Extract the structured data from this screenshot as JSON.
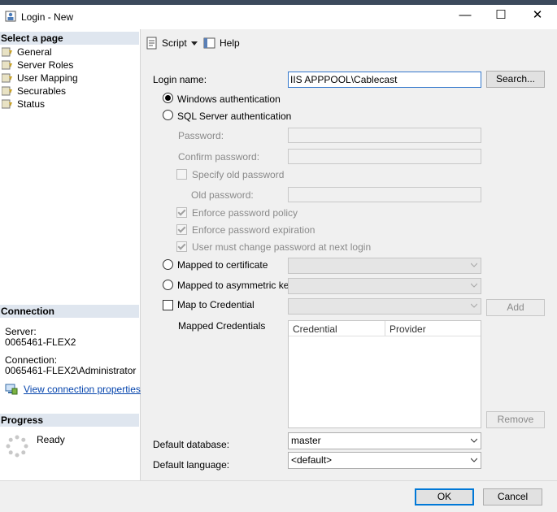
{
  "window": {
    "title": "Login - New",
    "minimize": "—",
    "maximize": "☐",
    "close": "✕"
  },
  "sidebar": {
    "select_page_header": "Select a page",
    "items": [
      {
        "label": "General",
        "icon": "page-icon"
      },
      {
        "label": "Server Roles",
        "icon": "page-icon"
      },
      {
        "label": "User Mapping",
        "icon": "page-icon"
      },
      {
        "label": "Securables",
        "icon": "page-icon"
      },
      {
        "label": "Status",
        "icon": "page-icon"
      }
    ],
    "connection_header": "Connection",
    "server_label": "Server:",
    "server_value": "0065461-FLEX2",
    "connection_label": "Connection:",
    "connection_value": "0065461-FLEX2\\Administrator",
    "view_connection_link": "View connection properties",
    "progress_header": "Progress",
    "progress_status": "Ready"
  },
  "toolbar": {
    "script_label": "Script",
    "help_label": "Help"
  },
  "form": {
    "login_name_label": "Login name:",
    "login_name_value": "IIS APPPOOL\\Cablecast",
    "search_button": "Search...",
    "windows_auth": "Windows authentication",
    "sql_auth": "SQL Server authentication",
    "password_label": "Password:",
    "confirm_password_label": "Confirm password:",
    "specify_old_password": "Specify old password",
    "old_password_label": "Old password:",
    "enforce_policy": "Enforce password policy",
    "enforce_expiration": "Enforce password expiration",
    "must_change": "User must change password at next login",
    "mapped_certificate": "Mapped to certificate",
    "mapped_asym_key": "Mapped to asymmetric key",
    "map_credential": "Map to Credential",
    "add_button": "Add",
    "mapped_credentials_label": "Mapped Credentials",
    "cred_columns": [
      "Credential",
      "Provider"
    ],
    "remove_button": "Remove",
    "default_database_label": "Default database:",
    "default_database_value": "master",
    "default_language_label": "Default language:",
    "default_language_value": "<default>"
  },
  "footer": {
    "ok_button": "OK",
    "cancel_button": "Cancel"
  }
}
